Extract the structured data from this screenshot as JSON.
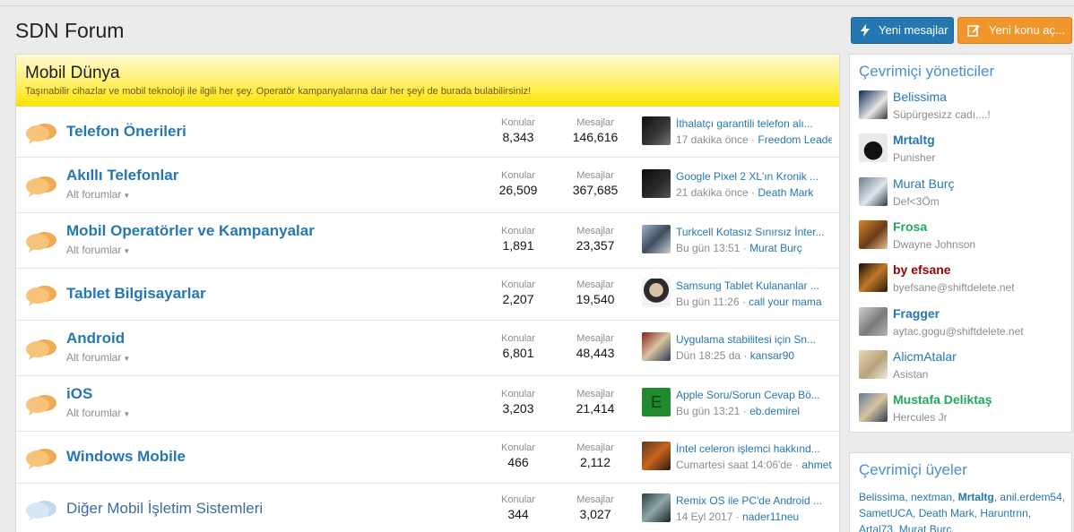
{
  "page": {
    "title": "SDN Forum"
  },
  "actions": {
    "new_messages": "Yeni mesajlar",
    "new_topic": "Yeni konu aç..."
  },
  "category": {
    "title": "Mobil Dünya",
    "description": "Taşınabilir cihazlar ve mobil teknoloji ile ilgili her şey. Operatör kampanyalarına dair her şeyi de burada bulabilirsiniz!"
  },
  "labels": {
    "topics": "Konular",
    "messages": "Mesajlar",
    "subforums": "Alt forumlar",
    "caret": "▼"
  },
  "forums": [
    {
      "title": "Telefon Önerileri",
      "has_sub": false,
      "topics": "8,343",
      "messages": "146,616",
      "last_title": "İthalatçı garantili telefon alı...",
      "last_time": "17 dakika önce · ",
      "last_user": "Freedom Leader"
    },
    {
      "title": "Akıllı Telefonlar",
      "has_sub": true,
      "topics": "26,509",
      "messages": "367,685",
      "last_title": "Google Pixel 2 XL'ın Kronik ...",
      "last_time": "21 dakika önce · ",
      "last_user": "Death Mark"
    },
    {
      "title": "Mobil Operatörler ve Kampanyalar",
      "has_sub": true,
      "topics": "1,891",
      "messages": "23,357",
      "last_title": "Turkcell Kotasız Sınırsız İnter...",
      "last_time": "Bu gün 13:51 · ",
      "last_user": "Murat Burç"
    },
    {
      "title": "Tablet Bilgisayarlar",
      "has_sub": false,
      "topics": "2,207",
      "messages": "19,540",
      "last_title": "Samsung Tablet Kulananlar ...",
      "last_time": "Bu gün 11:26 · ",
      "last_user": "call your mama"
    },
    {
      "title": "Android",
      "has_sub": true,
      "topics": "6,801",
      "messages": "48,443",
      "last_title": "Uygulama stabilitesi için Sn...",
      "last_time": "Dün 18:25 da · ",
      "last_user": "kansar90"
    },
    {
      "title": "iOS",
      "has_sub": true,
      "topics": "3,203",
      "messages": "21,414",
      "last_title": "Apple Soru/Sorun Cevap Bö...",
      "last_time": "Bu gün 13:21 · ",
      "last_user": "eb.demirel",
      "avatar_letter": "E"
    },
    {
      "title": "Windows Mobile",
      "has_sub": false,
      "topics": "466",
      "messages": "2,112",
      "last_title": "İntel celeron işlemci hakkınd...",
      "last_time": "Cumartesi saat 14:06'de · ",
      "last_user": "ahmet"
    },
    {
      "title": "Diğer Mobil İşletim Sistemleri",
      "has_sub": false,
      "topics": "344",
      "messages": "3,027",
      "last_title": "Remix OS ile PC'de Android ...",
      "last_time": "14 Eyl 2017 · ",
      "last_user": "nader11neu"
    }
  ],
  "sidebar": {
    "mods_title": "Çevrimiçi yöneticiler",
    "mods": [
      {
        "name": "Belissima",
        "title": "Süpürgesizz cadı....!"
      },
      {
        "name": "Mrtaltg",
        "title": "Punisher"
      },
      {
        "name": "Murat Burç",
        "title": "Def<3Öm"
      },
      {
        "name": "Frosa",
        "title": "Dwayne Johnson"
      },
      {
        "name": "by efsane",
        "title": "byefsane@shiftdelete.net"
      },
      {
        "name": "Fragger",
        "title": "aytac.gogu@shiftdelete.net"
      },
      {
        "name": "AlicmAtalar",
        "title": "Asistan"
      },
      {
        "name": "Mustafa Deliktaş",
        "title": "Hercules Jr"
      }
    ],
    "members_title": "Çevrimiçi üyeler",
    "members": [
      "Belissima",
      "nextman",
      "Mrtaltg",
      "anil.erdem54",
      "SametUCA",
      "Death Mark",
      "Haruntrnn",
      "Artal73",
      "Murat Burç"
    ]
  }
}
